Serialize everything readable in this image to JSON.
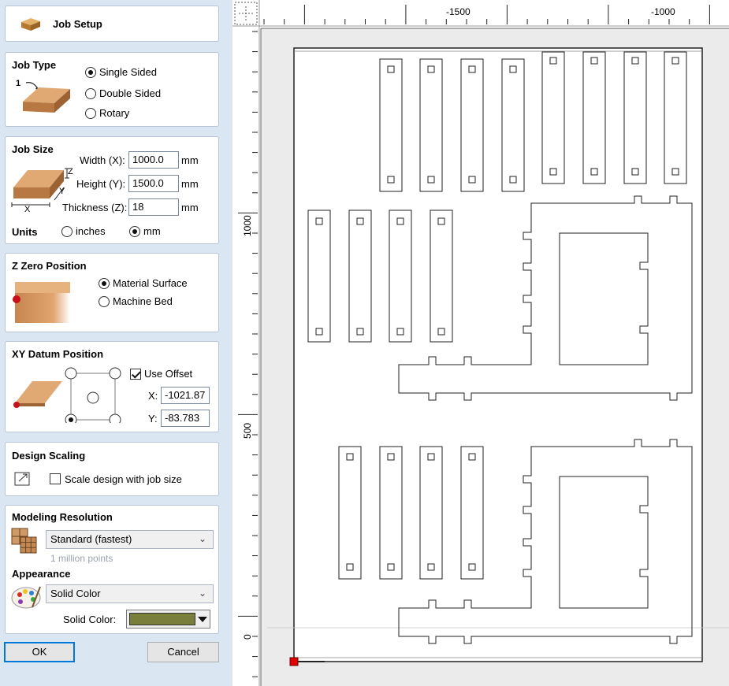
{
  "job_setup": {
    "title": "Job Setup"
  },
  "job_type": {
    "title": "Job Type",
    "image_label": "1",
    "options": [
      "Single Sided",
      "Double Sided",
      "Rotary"
    ],
    "selected": "Single Sided"
  },
  "job_size": {
    "title": "Job Size",
    "width_label": "Width (X):",
    "width_value": "1000.0",
    "width_unit": "mm",
    "height_label": "Height (Y):",
    "height_value": "1500.0",
    "height_unit": "mm",
    "thickness_label": "Thickness (Z):",
    "thickness_value": "18",
    "thickness_unit": "mm",
    "axis_z": "Z",
    "axis_y": "Y",
    "axis_x": "X",
    "units_label": "Units",
    "units_options": [
      "inches",
      "mm"
    ],
    "units_selected": "mm"
  },
  "z_zero": {
    "title": "Z Zero Position",
    "options": [
      "Material Surface",
      "Machine Bed"
    ],
    "selected": "Material Surface"
  },
  "xy_datum": {
    "title": "XY Datum Position",
    "use_offset_label": "Use Offset",
    "use_offset_checked": true,
    "x_label": "X:",
    "x_value": "-1021.87",
    "y_label": "Y:",
    "y_value": "-83.783"
  },
  "design_scaling": {
    "title": "Design Scaling",
    "scale_label": "Scale design with job size",
    "scale_checked": false
  },
  "modeling": {
    "title": "Modeling Resolution",
    "resolution": "Standard (fastest)",
    "hint": "1 million points"
  },
  "appearance": {
    "title": "Appearance",
    "mode": "Solid Color",
    "solid_color_label": "Solid Color:",
    "solid_color": "#7a7e3b"
  },
  "buttons": {
    "ok": "OK",
    "cancel": "Cancel"
  },
  "rulers": {
    "top_labels": [
      "-1500",
      "-1000"
    ],
    "left_labels": [
      "1000",
      "500",
      "0"
    ]
  },
  "colors": {
    "origin_marker": "#e00000",
    "panel_bg": "#dbe6f3"
  }
}
